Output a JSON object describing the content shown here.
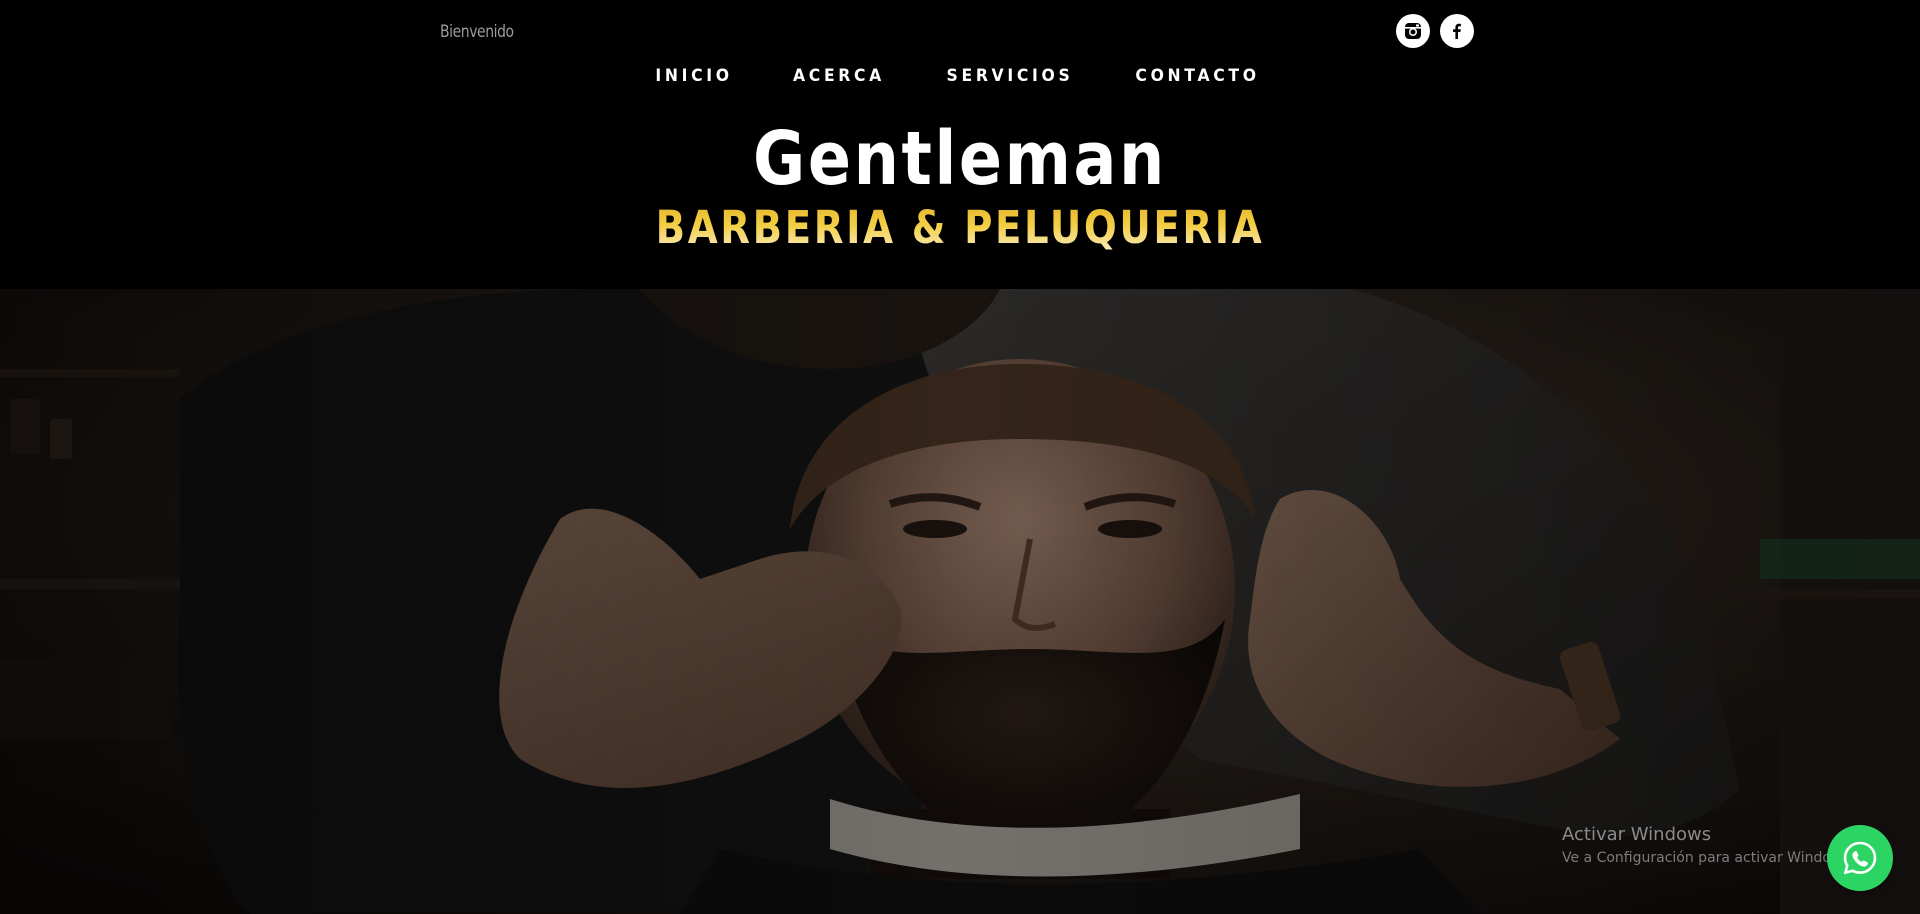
{
  "header": {
    "welcome": "Bienvenido",
    "social": [
      {
        "name": "instagram-icon"
      },
      {
        "name": "facebook-icon"
      }
    ]
  },
  "nav": {
    "items": [
      {
        "label": "INICIO"
      },
      {
        "label": "ACERCA"
      },
      {
        "label": "SERVICIOS"
      },
      {
        "label": "CONTACTO"
      }
    ]
  },
  "brand": {
    "title": "Gentleman",
    "subtitle": "BARBERIA & PELUQUERIA"
  },
  "watermark": {
    "title": "Activar Windows",
    "subtitle": "Ve a Configuración para activar Windows."
  },
  "whatsapp": {
    "icon": "whatsapp-icon"
  },
  "colors": {
    "background": "#000000",
    "accent_gold": "#e9c233",
    "whatsapp_green": "#2bd463"
  }
}
